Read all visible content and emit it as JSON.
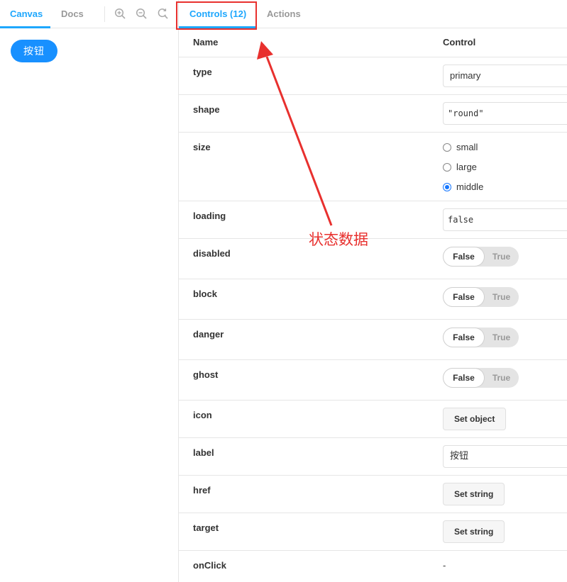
{
  "toolbar": {
    "tabs": [
      {
        "label": "Canvas",
        "active": true
      },
      {
        "label": "Docs",
        "active": false
      }
    ],
    "icons": [
      "zoom-in-icon",
      "zoom-out-icon",
      "zoom-reset-icon"
    ]
  },
  "canvas": {
    "preview_button_label": "按钮"
  },
  "addons": {
    "tabs": [
      {
        "label": "Controls (12)",
        "active": true
      },
      {
        "label": "Actions",
        "active": false
      }
    ],
    "table": {
      "headers": {
        "name": "Name",
        "control": "Control"
      },
      "rows": [
        {
          "name": "type",
          "control": "text",
          "value": "primary"
        },
        {
          "name": "shape",
          "control": "object",
          "value": "\"round\""
        },
        {
          "name": "size",
          "control": "radio",
          "options": [
            "small",
            "large",
            "middle"
          ],
          "selected": "middle"
        },
        {
          "name": "loading",
          "control": "object",
          "value": "false"
        },
        {
          "name": "disabled",
          "control": "boolean",
          "on_label": "False",
          "off_label": "True"
        },
        {
          "name": "block",
          "control": "boolean",
          "on_label": "False",
          "off_label": "True"
        },
        {
          "name": "danger",
          "control": "boolean",
          "on_label": "False",
          "off_label": "True"
        },
        {
          "name": "ghost",
          "control": "boolean",
          "on_label": "False",
          "off_label": "True"
        },
        {
          "name": "icon",
          "control": "button",
          "label": "Set object"
        },
        {
          "name": "label",
          "control": "text",
          "value": "按钮"
        },
        {
          "name": "href",
          "control": "button",
          "label": "Set string"
        },
        {
          "name": "target",
          "control": "button",
          "label": "Set string"
        },
        {
          "name": "onClick",
          "control": "none",
          "value": "-"
        }
      ]
    }
  },
  "annotation": {
    "text": "状态数据",
    "color": "#e8302e"
  },
  "colors": {
    "accent": "#1ea7fd",
    "primary_button": "#1890ff",
    "radio_selected": "#1677ff"
  }
}
